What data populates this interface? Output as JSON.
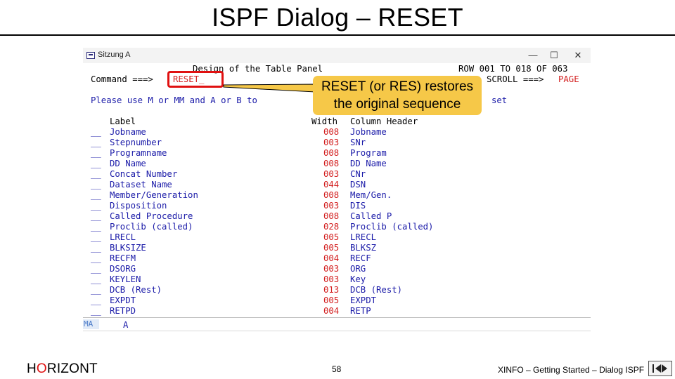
{
  "slide": {
    "title": "ISPF Dialog – RESET",
    "footer_logo_h": "H",
    "footer_logo_o": "O",
    "footer_logo_rest": "RIZONT",
    "page_number": "58",
    "footer_text": "XINFO – Getting Started – Dialog ISPF"
  },
  "window": {
    "title": "Sitzung A",
    "minimize": "—",
    "maximize": "☐",
    "close": "✕"
  },
  "panel": {
    "heading": "Design of the Table Panel",
    "row_info": "ROW 001 TO 018 OF 063",
    "command_label": "Command ===>",
    "command_value": "RESET_",
    "scroll_label": "SCROLL ===>",
    "scroll_value": "PAGE",
    "instruction_prefix": "Please use M or MM and A or B to",
    "instruction_suffix": "set",
    "col_label": "Label",
    "col_width": "Width",
    "col_header": "Column Header",
    "rows": [
      {
        "sel": "__",
        "label": "Jobname",
        "width": "008",
        "header": "Jobname"
      },
      {
        "sel": "__",
        "label": "Stepnumber",
        "width": "003",
        "header": "SNr"
      },
      {
        "sel": "__",
        "label": "Programname",
        "width": "008",
        "header": "Program"
      },
      {
        "sel": "__",
        "label": "DD Name",
        "width": "008",
        "header": "DD Name"
      },
      {
        "sel": "__",
        "label": "Concat Number",
        "width": "003",
        "header": "CNr"
      },
      {
        "sel": "__",
        "label": "Dataset Name",
        "width": "044",
        "header": "DSN"
      },
      {
        "sel": "__",
        "label": "Member/Generation",
        "width": "008",
        "header": "Mem/Gen."
      },
      {
        "sel": "__",
        "label": "Disposition",
        "width": "003",
        "header": "DIS"
      },
      {
        "sel": "__",
        "label": "Called Procedure",
        "width": "008",
        "header": "Called P"
      },
      {
        "sel": "__",
        "label": "Proclib (called)",
        "width": "028",
        "header": "Proclib (called)"
      },
      {
        "sel": "__",
        "label": "LRECL",
        "width": "005",
        "header": "LRECL"
      },
      {
        "sel": "__",
        "label": "BLKSIZE",
        "width": "005",
        "header": "BLKSZ"
      },
      {
        "sel": "__",
        "label": "RECFM",
        "width": "004",
        "header": "RECF"
      },
      {
        "sel": "__",
        "label": "DSORG",
        "width": "003",
        "header": "ORG"
      },
      {
        "sel": "__",
        "label": "KEYLEN",
        "width": "003",
        "header": "Key"
      },
      {
        "sel": "__",
        "label": "DCB (Rest)",
        "width": "013",
        "header": "DCB (Rest)"
      },
      {
        "sel": "__",
        "label": "EXPDT",
        "width": "005",
        "header": "EXPDT"
      },
      {
        "sel": "__",
        "label": "RETPD",
        "width": "004",
        "header": "RETP"
      }
    ],
    "status_ma": "MA",
    "status_a": "A"
  },
  "callout": {
    "line1": "RESET (or RES) restores",
    "line2": "the original sequence"
  },
  "colors": {
    "terminal_blue": "#1a1aa8",
    "terminal_red": "#d32020",
    "callout_fill": "#f6c848",
    "highlight_red": "#e01010"
  }
}
